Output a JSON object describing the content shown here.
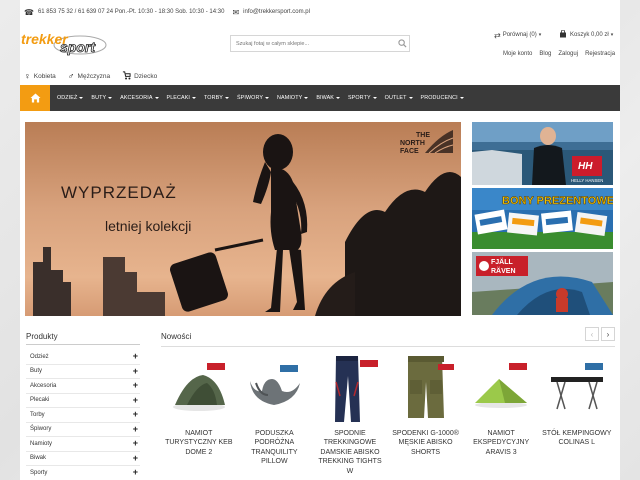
{
  "topbar": {
    "phone": "61 853 75 32 / 61 639 07 24 Pon.-Pt. 10:30 - 18:30 Sob. 10:30 - 14:30",
    "email": "info@trekkersport.com.pl"
  },
  "logo": {
    "part1": "trekker",
    "part2": "sport"
  },
  "search": {
    "placeholder": "Szukaj fotaj w całym sklepie..."
  },
  "header_links": {
    "compare": "Porównaj (0)",
    "cart": "Koszyk 0,00 zł",
    "account": "Moje konto",
    "blog": "Blog",
    "login": "Zaloguj",
    "register": "Rejestracja"
  },
  "gender": {
    "women": "Kobieta",
    "men": "Mężczyzna",
    "kids": "Dziecko"
  },
  "nav": {
    "items": [
      "ODZIEŻ",
      "BUTY",
      "AKCESORIA",
      "PLECAKI",
      "TORBY",
      "ŚPIWORY",
      "NAMIOTY",
      "BIWAK",
      "SPORTY",
      "OUTLET",
      "PRODUCENCI"
    ]
  },
  "hero": {
    "line1": "WYPRZEDAŻ",
    "line2": "letniej kolekcji",
    "brand1": "THE",
    "brand2": "NORTH",
    "brand3": "FACE"
  },
  "side_banners": {
    "hh": "HH",
    "hh_sub": "HELLY HANSEN",
    "vouchers": "BONY PREZENTOWE",
    "fr1": "FJÄLL",
    "fr2": "RÄVEN"
  },
  "sidebar": {
    "title": "Produkty",
    "categories": [
      "Odzież",
      "Buty",
      "Akcesoria",
      "Plecaki",
      "Torby",
      "Śpiwory",
      "Namioty",
      "Biwak",
      "Sporty"
    ]
  },
  "new": {
    "title": "Nowości",
    "products": [
      "NAMIOT TURYSTYCZNY KEB DOME 2",
      "PODUSZKA PODRÓŻNA TRANQUILITY PILLOW",
      "SPODNIE TREKKINGOWE DAMSKIE ABISKO TREKKING TIGHTS W",
      "SPODENKI G-1000® MĘSKIE ABISKO SHORTS",
      "NAMIOT EKSPEDYCYJNY ARAVIS 3",
      "STÓŁ KEMPINGOWY COLINAS L"
    ]
  },
  "colors": {
    "accent": "#f39c12",
    "nav_bg": "#3a3a3a"
  }
}
